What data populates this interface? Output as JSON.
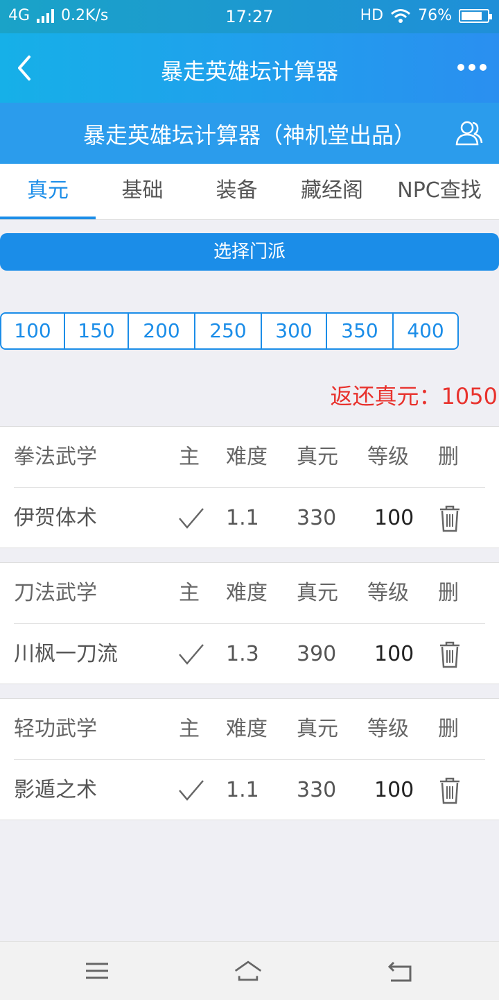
{
  "status_bar": {
    "network": "4G",
    "speed": "0.2K/s",
    "time": "17:27",
    "hd": "HD",
    "battery": "76%"
  },
  "header": {
    "title": "暴走英雄坛计算器"
  },
  "subheader": {
    "title": "暴走英雄坛计算器（神机堂出品）"
  },
  "tabs": [
    "真元",
    "基础",
    "装备",
    "藏经阁",
    "NPC查找"
  ],
  "select_button": "选择门派",
  "levels": [
    "100",
    "150",
    "200",
    "250",
    "300",
    "350",
    "400"
  ],
  "return_zhenyuan": "返还真元：1050",
  "columns": {
    "main": "主",
    "difficulty": "难度",
    "zhenyuan": "真元",
    "level": "等级",
    "delete": "删"
  },
  "skills": [
    {
      "category": "拳法武学",
      "name": "伊贺体术",
      "difficulty": "1.1",
      "zhenyuan": "330",
      "level": "100"
    },
    {
      "category": "刀法武学",
      "name": "川枫一刀流",
      "difficulty": "1.3",
      "zhenyuan": "390",
      "level": "100"
    },
    {
      "category": "轻功武学",
      "name": "影遁之术",
      "difficulty": "1.1",
      "zhenyuan": "330",
      "level": "100"
    }
  ],
  "colors": {
    "accent": "#1b8de8",
    "header": "#2a8ff0",
    "warning_text": "#e8322d"
  }
}
